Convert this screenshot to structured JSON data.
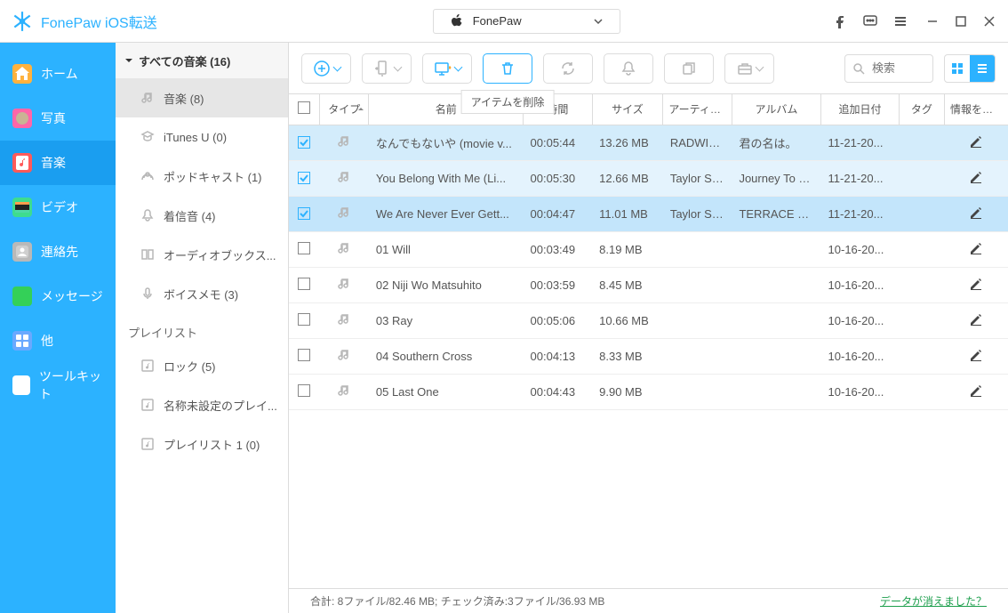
{
  "app": {
    "title": "FonePaw iOS転送"
  },
  "device": {
    "name": "FonePaw"
  },
  "tooltip_delete": "アイテムを削除",
  "search": {
    "placeholder": "検索"
  },
  "nav": [
    {
      "id": "home",
      "label": "ホーム",
      "color": "#ffb23e"
    },
    {
      "id": "photos",
      "label": "写真",
      "color": "#ff66a8"
    },
    {
      "id": "music",
      "label": "音楽",
      "color": "#ff5a5a",
      "active": true
    },
    {
      "id": "video",
      "label": "ビデオ",
      "color": "#3edc8f"
    },
    {
      "id": "contacts",
      "label": "連絡先",
      "color": "#b9b9b9"
    },
    {
      "id": "messages",
      "label": "メッセージ",
      "color": "#34d058"
    },
    {
      "id": "other",
      "label": "他",
      "color": "#6aa9ff"
    },
    {
      "id": "toolkit",
      "label": "ツールキット",
      "color": "#ffffff"
    }
  ],
  "tree": {
    "header": "すべての音楽 (16)",
    "items": [
      {
        "id": "songs",
        "label": "音楽 (8)",
        "selected": true
      },
      {
        "id": "itunesu",
        "label": "iTunes U (0)"
      },
      {
        "id": "podcasts",
        "label": "ポッドキャスト (1)"
      },
      {
        "id": "ringtones",
        "label": "着信音 (4)"
      },
      {
        "id": "audiobooks",
        "label": "オーディオブックス..."
      },
      {
        "id": "voicememo",
        "label": "ボイスメモ (3)"
      }
    ],
    "playlist_header": "プレイリスト",
    "playlists": [
      {
        "id": "rock",
        "label": "ロック (5)"
      },
      {
        "id": "unnamed",
        "label": "名称未設定のプレイ..."
      },
      {
        "id": "pl1",
        "label": "プレイリスト 1 (0)"
      }
    ]
  },
  "columns": {
    "type": "タイプ",
    "name": "名前",
    "time": "時間",
    "size": "サイズ",
    "artist": "アーティスト",
    "album": "アルバム",
    "date": "追加日付",
    "tag": "タグ",
    "edit": "情報を編集"
  },
  "rows": [
    {
      "sel": true,
      "name": "なんでもないや (movie v...",
      "time": "00:05:44",
      "size": "13.26 MB",
      "artist": "RADWIM...",
      "album": "君の名は。",
      "date": "11-21-20..."
    },
    {
      "sel": true,
      "name": "You Belong With Me (Li...",
      "time": "00:05:30",
      "size": "12.66 MB",
      "artist": "Taylor Sw...",
      "album": "Journey To F...",
      "date": "11-21-20..."
    },
    {
      "sel": true,
      "name": "We Are Never Ever Gett...",
      "time": "00:04:47",
      "size": "11.01 MB",
      "artist": "Taylor Sw...",
      "album": "TERRACE HO...",
      "date": "11-21-20..."
    },
    {
      "sel": false,
      "name": "01 Will",
      "time": "00:03:49",
      "size": "8.19 MB",
      "artist": "",
      "album": "",
      "date": "10-16-20..."
    },
    {
      "sel": false,
      "name": "02 Niji Wo Matsuhito",
      "time": "00:03:59",
      "size": "8.45 MB",
      "artist": "",
      "album": "",
      "date": "10-16-20..."
    },
    {
      "sel": false,
      "name": "03 Ray",
      "time": "00:05:06",
      "size": "10.66 MB",
      "artist": "",
      "album": "",
      "date": "10-16-20..."
    },
    {
      "sel": false,
      "name": "04 Southern Cross",
      "time": "00:04:13",
      "size": "8.33 MB",
      "artist": "",
      "album": "",
      "date": "10-16-20..."
    },
    {
      "sel": false,
      "name": "05 Last One",
      "time": "00:04:43",
      "size": "9.90 MB",
      "artist": "",
      "album": "",
      "date": "10-16-20..."
    }
  ],
  "status": {
    "text": "合計: 8ファイル/82.46 MB; チェック済み:3ファイル/36.93 MB",
    "link": "データが消えました？"
  }
}
